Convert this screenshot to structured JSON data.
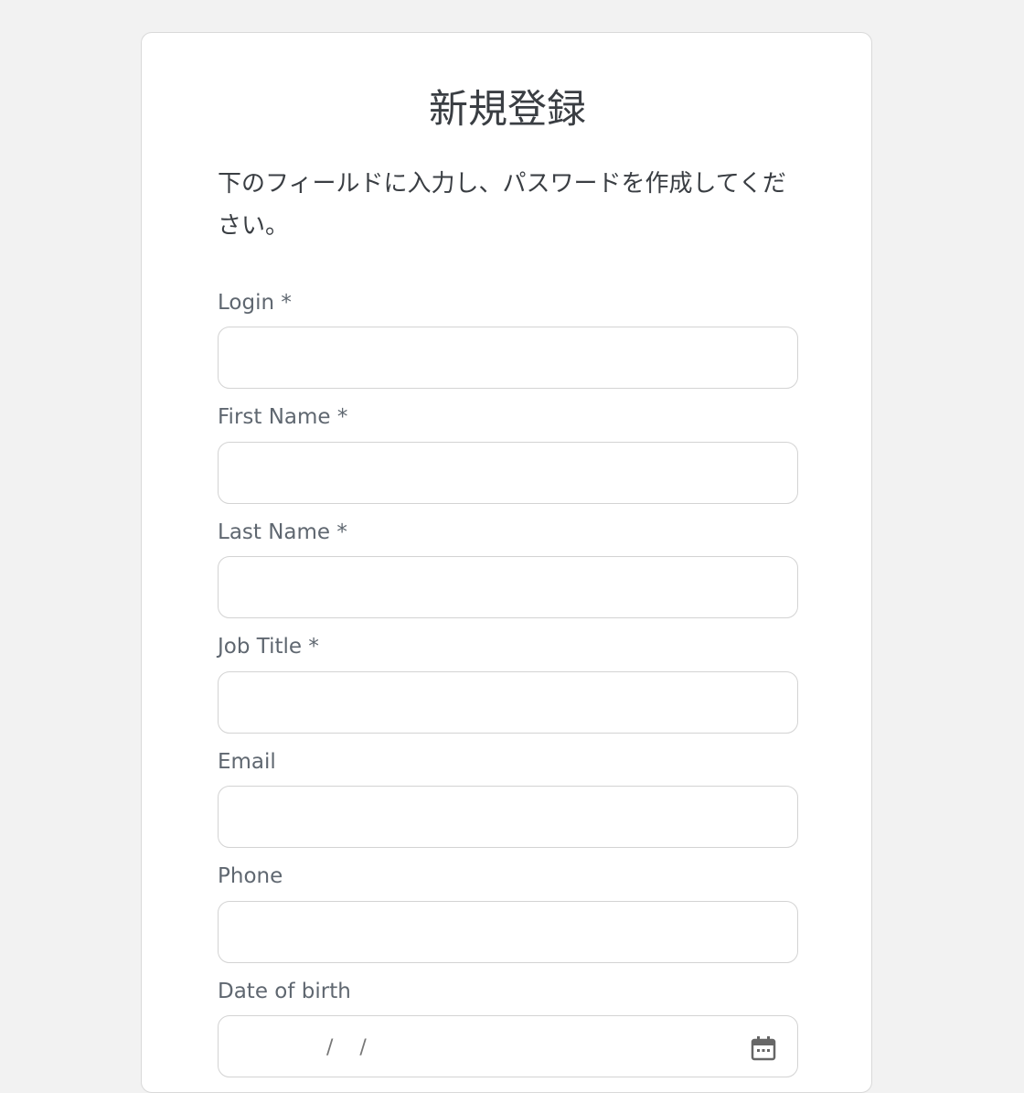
{
  "form": {
    "title": "新規登録",
    "description": "下のフィールドに入力し、パスワードを作成してください。",
    "fields": [
      {
        "label": "Login *",
        "value": "",
        "placeholder": ""
      },
      {
        "label": "First Name *",
        "value": "",
        "placeholder": ""
      },
      {
        "label": "Last Name *",
        "value": "",
        "placeholder": ""
      },
      {
        "label": "Job Title *",
        "value": "",
        "placeholder": ""
      },
      {
        "label": "Email",
        "value": "",
        "placeholder": ""
      },
      {
        "label": "Phone",
        "value": "",
        "placeholder": ""
      },
      {
        "label": "Date of birth",
        "value": "",
        "placeholder": "    /   /"
      }
    ],
    "date_icon": "calendar-icon"
  },
  "colors": {
    "background": "#f2f2f2",
    "card": "#ffffff",
    "title_text": "#3a3e43",
    "label_text": "#5f6770",
    "input_border": "#d3d3d3"
  }
}
